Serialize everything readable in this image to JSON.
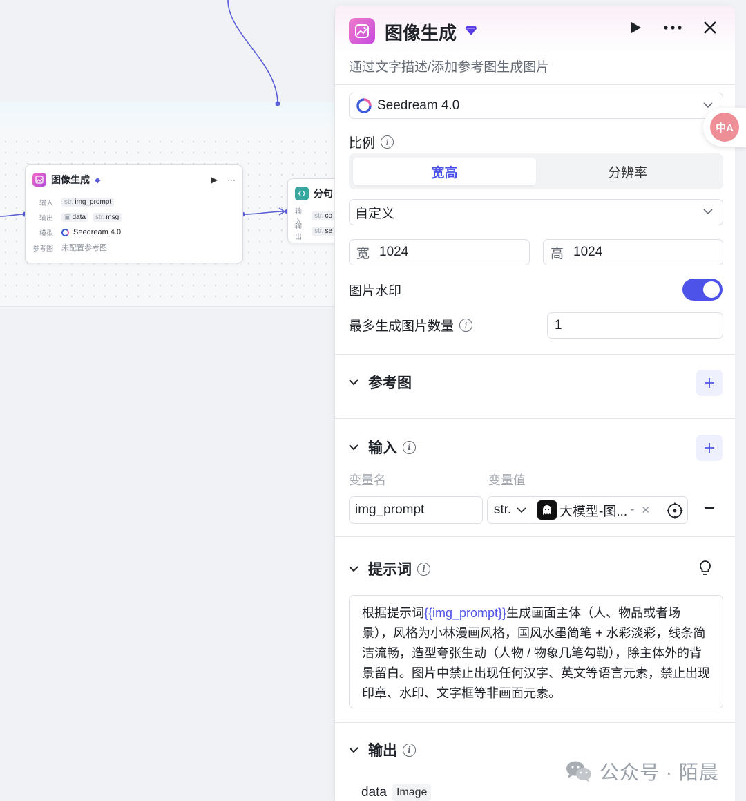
{
  "canvas": {
    "node": {
      "title": "图像生成",
      "input_label": "输入",
      "input_type": "str.",
      "input_value": "img_prompt",
      "output_label": "输出",
      "output_chip1": "data",
      "output_type2": "str.",
      "output_chip2": "msg",
      "model_label": "模型",
      "model_value": "Seedream 4.0",
      "ref_label": "参考图",
      "ref_value": "未配置参考图"
    },
    "split_node": {
      "title": "分句",
      "input_label": "输入",
      "input_type": "str.",
      "input_value": "co",
      "output_label": "输出",
      "output_type": "str.",
      "output_value": "se"
    }
  },
  "panel": {
    "title": "图像生成",
    "description": "通过文字描述/添加参考图生成图片",
    "model": "Seedream 4.0",
    "ratio_label": "比例",
    "tabs": [
      "宽高",
      "分辨率"
    ],
    "ratio_select": "自定义",
    "width_label": "宽",
    "width_value": "1024",
    "height_label": "高",
    "height_value": "1024",
    "watermark_label": "图片水印",
    "watermark_on": true,
    "max_count_label": "最多生成图片数量",
    "max_count_value": "1",
    "reference_title": "参考图",
    "input_title": "输入",
    "col_var_name": "变量名",
    "col_var_value": "变量值",
    "var_name": "img_prompt",
    "var_type": "str.",
    "var_ref": "大模型-图...",
    "var_ref_suffix": "-",
    "prompt_title": "提示词",
    "prompt_pre": "根据提示词",
    "prompt_var": "{{img_prompt}}",
    "prompt_post": "生成画面主体（人、物品或者场景），风格为小林漫画风格，国风水墨简笔 + 水彩淡彩，线条简洁流畅，造型夸张生动（人物 / 物象几笔勾勒），除主体外的背景留白。图片中禁止出现任何汉字、英文等语言元素，禁止出现印章、水印、文字框等非画面元素。",
    "output_title": "输出",
    "output_name": "data",
    "output_type": "Image"
  },
  "translate_fab": "中A",
  "watermark": "公众号 · 陌晨",
  "colors": {
    "accent": "#4d53e8",
    "brand_pink": "#e05ec4",
    "wire": "#5b5fd6"
  }
}
